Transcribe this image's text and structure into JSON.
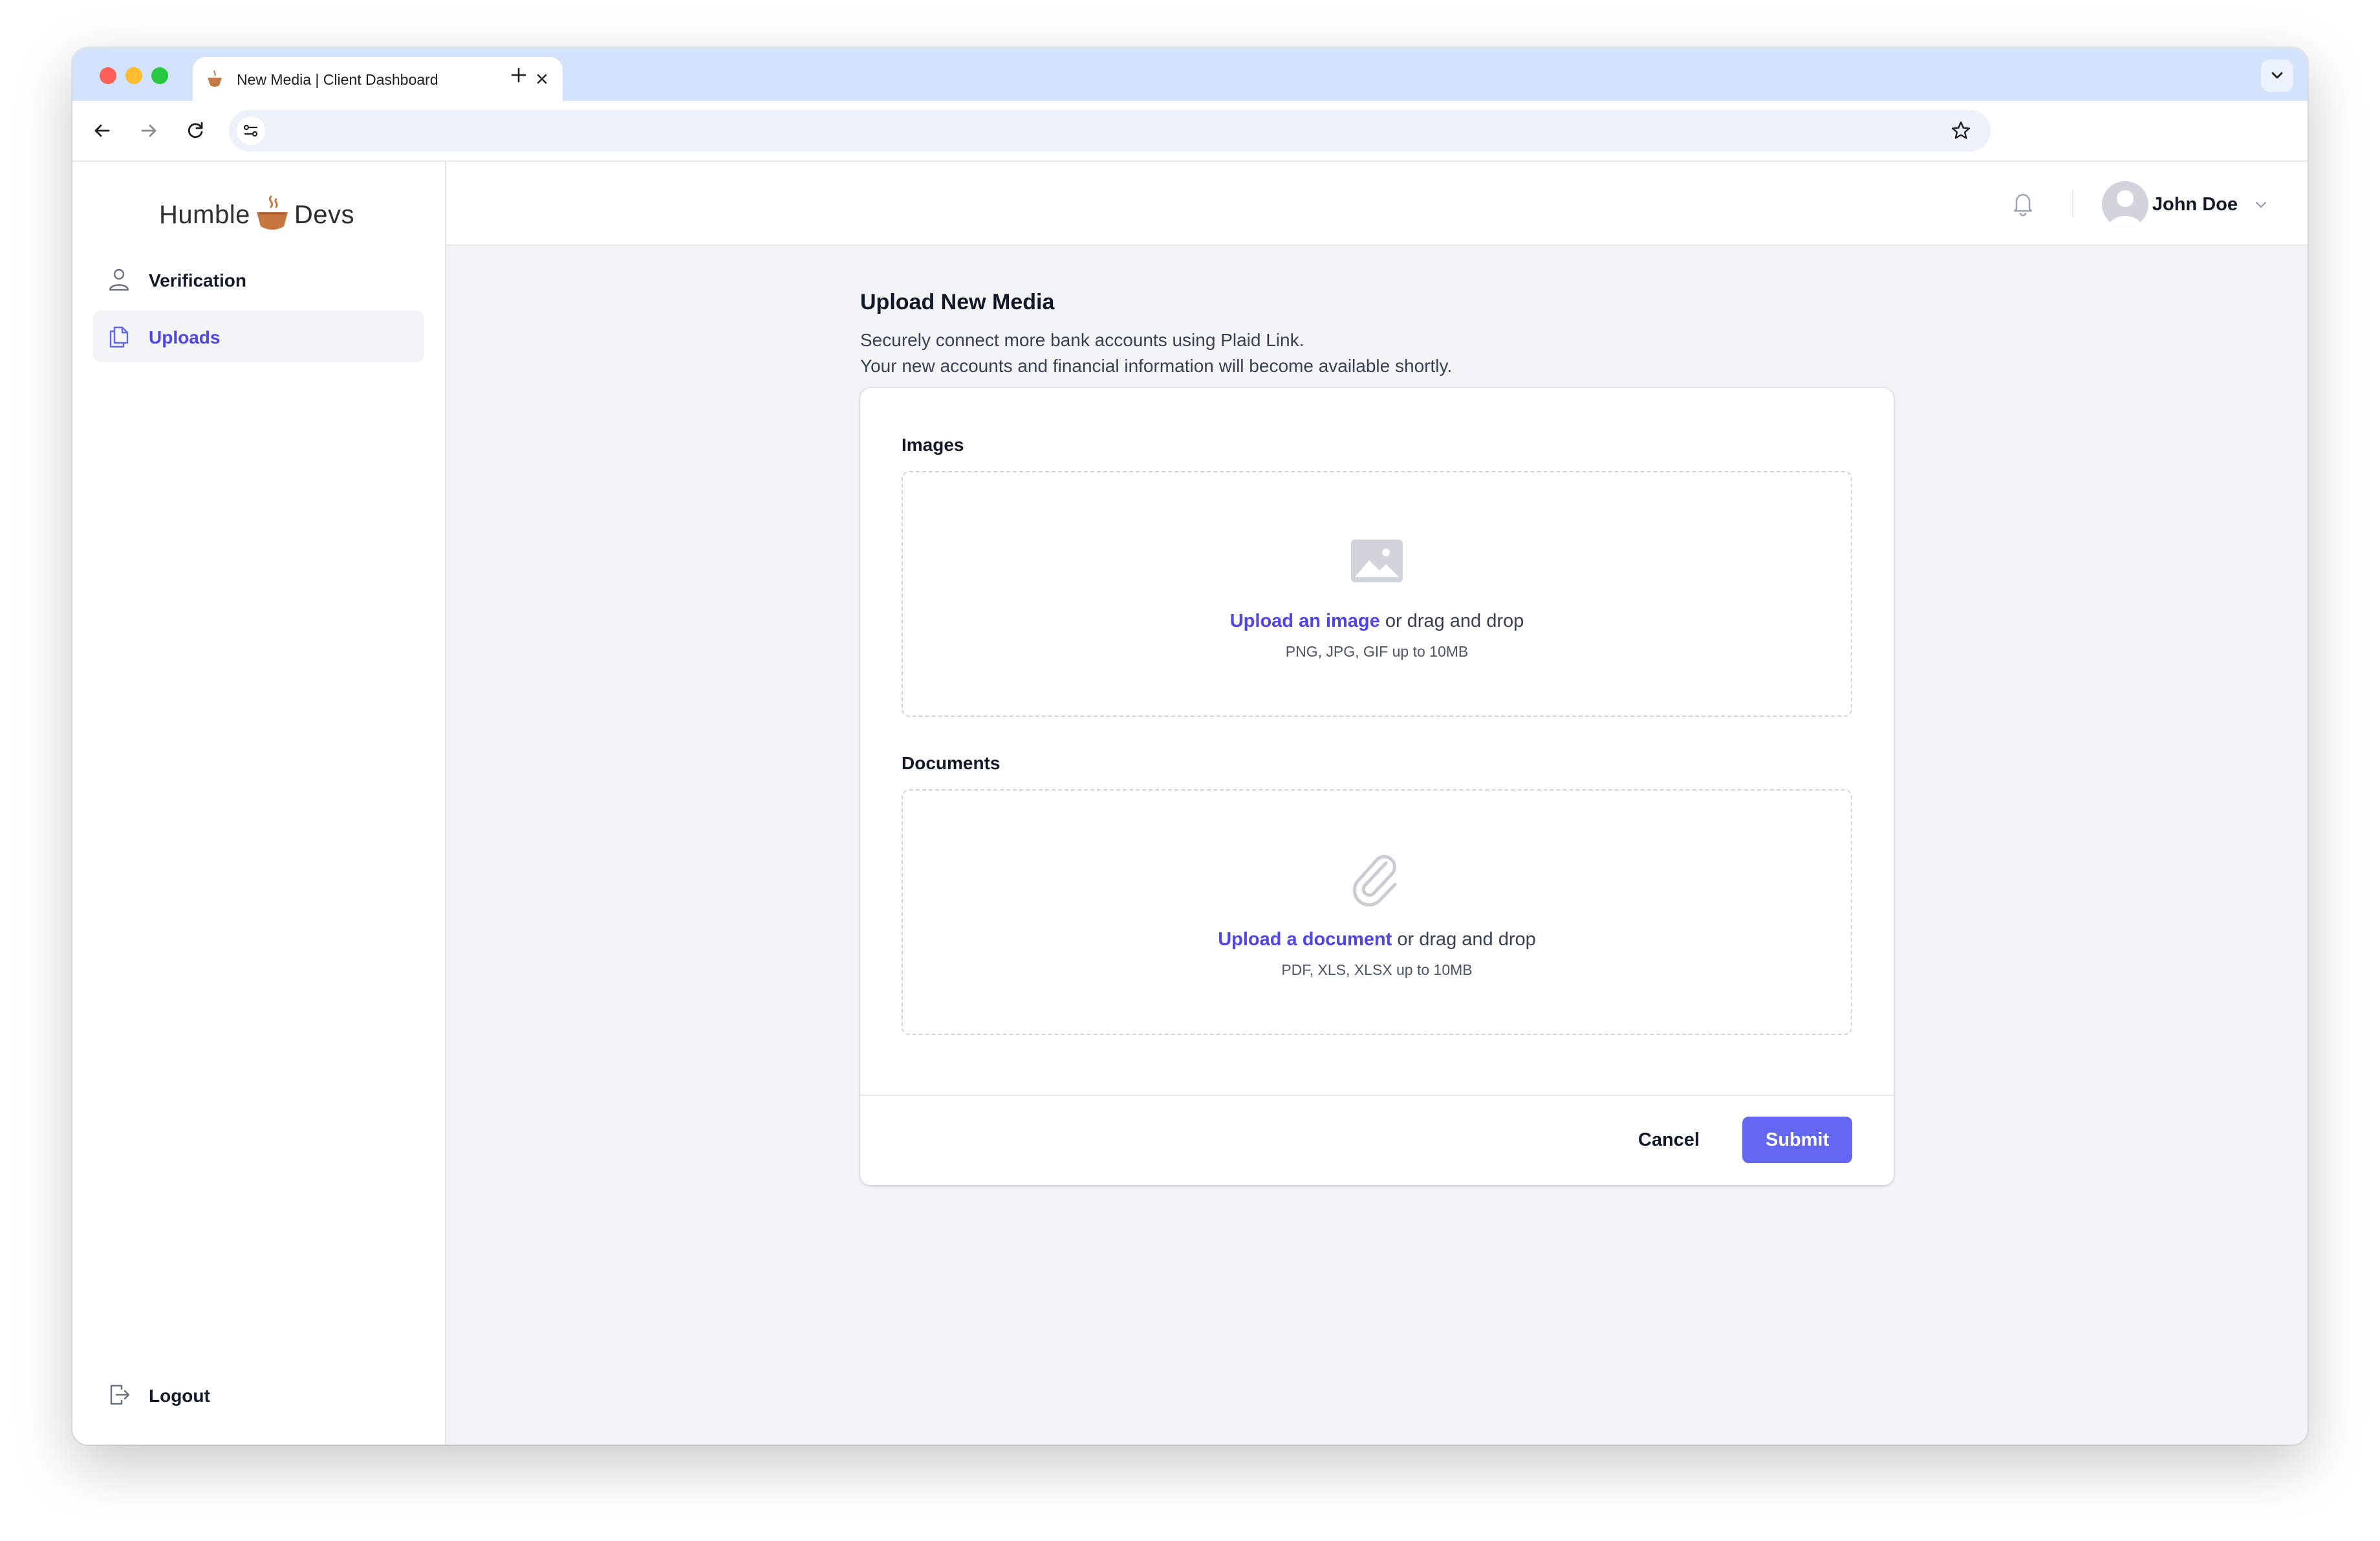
{
  "browser": {
    "tab_title": "New Media | Client Dashboard",
    "url": ""
  },
  "sidebar": {
    "logo_left": "Humble",
    "logo_right": "Devs",
    "items": [
      {
        "label": "Verification",
        "icon": "user-icon",
        "active": false
      },
      {
        "label": "Uploads",
        "icon": "documents-icon",
        "active": true
      }
    ],
    "logout_label": "Logout"
  },
  "header": {
    "user_name": "John Doe"
  },
  "main": {
    "title": "Upload New Media",
    "description_line1": "Securely connect more bank accounts using Plaid Link.",
    "description_line2": "Your new accounts and financial information will become available shortly.",
    "images": {
      "label": "Images",
      "link": "Upload an image",
      "suffix": " or drag and drop",
      "hint": "PNG, JPG, GIF up to 10MB"
    },
    "documents": {
      "label": "Documents",
      "link": "Upload a document",
      "suffix": " or drag and drop",
      "hint": "PDF, XLS, XLSX up to 10MB"
    },
    "cancel_label": "Cancel",
    "submit_label": "Submit"
  },
  "colors": {
    "accent": "#6366f1",
    "link": "#4f46e5",
    "tabstrip": "#d3e3fd",
    "background": "#f3f4f6"
  }
}
